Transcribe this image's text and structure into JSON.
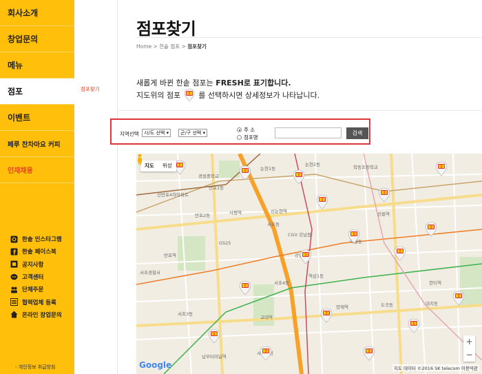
{
  "sidebar": {
    "items": [
      {
        "label": "회사소개"
      },
      {
        "label": "창업문의"
      },
      {
        "label": "메뉴"
      },
      {
        "label": "점포"
      },
      {
        "label": "이벤트"
      },
      {
        "label": "페루 찬차마요 커피"
      },
      {
        "label": "인재채용"
      }
    ],
    "social": [
      {
        "label": "한솥 인스타그램",
        "icon": "instagram-icon"
      },
      {
        "label": "한솥 페이스북",
        "icon": "facebook-icon"
      },
      {
        "label": "공지사항",
        "icon": "notice-icon"
      },
      {
        "label": "고객센터",
        "icon": "chat-icon"
      },
      {
        "label": "단체주문",
        "icon": "group-icon"
      },
      {
        "label": "협력업체 등록",
        "icon": "list-icon"
      },
      {
        "label": "온라인 창업문의",
        "icon": "home-icon"
      }
    ],
    "privacy": "- 개인정보 취급방침"
  },
  "subnav": {
    "item": "점포찾기"
  },
  "page": {
    "title": "점포찾기",
    "breadcrumb": {
      "home": "Home",
      "sep1": " > ",
      "mid": "한솥 점포",
      "sep2": " > ",
      "current": "점포찾기"
    },
    "intro_line1_pre": "새롭게 바뀐 한솥 점포는 ",
    "intro_line1_bold": "FRESH로 표기합니다.",
    "intro_line2_pre": "지도위의 점포",
    "intro_line2_post": "를 선택하시면 상세정보가 나타납니다."
  },
  "search": {
    "label": "지역선택",
    "select_city": "시/도 선택",
    "select_district": "군/구 선택",
    "radio_address": "주    소",
    "radio_store": "점포명",
    "button": "검색"
  },
  "map": {
    "type_map": "지도",
    "type_satellite": "위성",
    "google": "Google",
    "copyright": "지도 데이터 ©2016 SK telecom  이용약관",
    "zoom_in": "+",
    "zoom_out": "−",
    "labels": [
      "논현1동",
      "논현2동",
      "반포1동",
      "반포2동",
      "사평역",
      "신논현역",
      "역삼동",
      "서초동",
      "서초4동",
      "양재역",
      "남부터미널역",
      "교대역",
      "서초3동",
      "도곡동",
      "대치동",
      "역삼1동",
      "강남역",
      "GS25",
      "CGV 강남점",
      "학동초등학교",
      "신반포4차아파트",
      "경원중학교",
      "서초경찰서",
      "서초구청",
      "한티역",
      "선릉역",
      "반포역"
    ],
    "colors": {
      "brand": "#ffbf0b",
      "accent": "#e0333b",
      "link_red": "#e8411f"
    }
  }
}
